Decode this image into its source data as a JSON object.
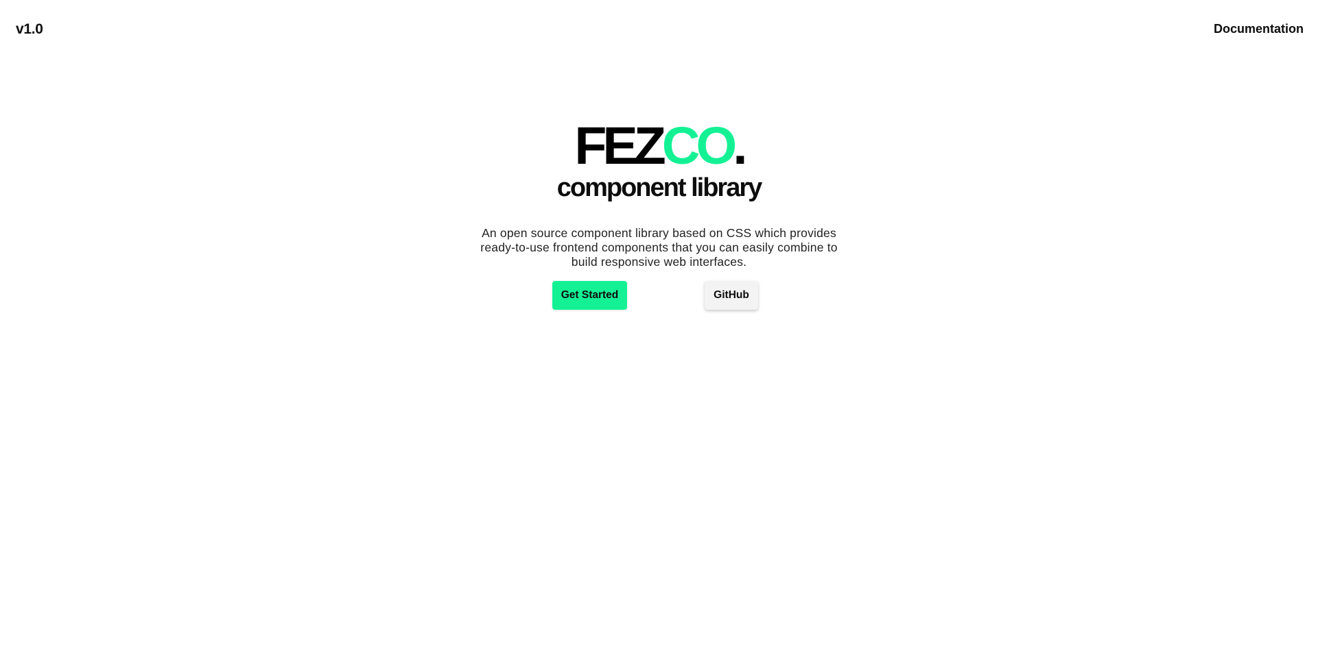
{
  "header": {
    "version": "v1.0",
    "documentation_label": "Documentation"
  },
  "hero": {
    "logo_dark": "FEZ",
    "logo_accent": "CO",
    "logo_dot": ".",
    "subtitle": "component library",
    "description": "An open source component library based on CSS which provides ready-to-use frontend components that you can easily combine to build responsive web interfaces."
  },
  "actions": {
    "get_started_label": "Get Started",
    "github_label": "GitHub"
  },
  "colors": {
    "accent": "#14f195",
    "text": "#0d0d0d",
    "background": "#ffffff",
    "secondary_button": "#f3f3f3"
  }
}
